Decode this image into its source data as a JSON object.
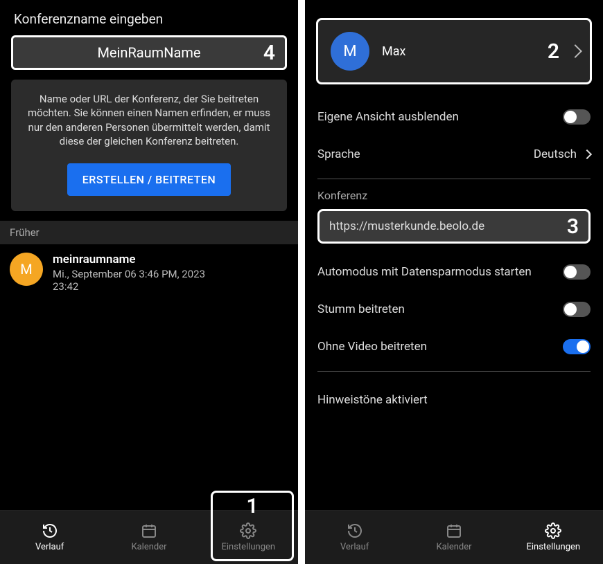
{
  "left": {
    "header": "Konferenzname eingeben",
    "room_input": "MeinRaumName",
    "badge4": "4",
    "info_text": "Name oder URL der Konferenz, der Sie beitreten möchten. Sie können einen Namen erfinden, er muss nur den anderen Personen übermittelt werden, damit diese der gleichen Konferenz beitreten.",
    "create_btn": "ERSTELLEN / BEITRETEN",
    "earlier_label": "Früher",
    "history": {
      "avatar_letter": "M",
      "title": "meinraumname",
      "subtitle": "Mi., September 06 3:46 PM, 2023",
      "duration": "23:42"
    },
    "badge1": "1"
  },
  "right": {
    "profile": {
      "avatar_letter": "M",
      "name": "Max",
      "badge2": "2"
    },
    "hide_self": "Eigene Ansicht ausblenden",
    "language_label": "Sprache",
    "language_value": "Deutsch",
    "conference_section": "Konferenz",
    "url": "https://musterkunde.beolo.de",
    "badge3": "3",
    "auto_mode": "Automodus mit Datensparmodus starten",
    "mute_join": "Stumm beitreten",
    "no_video": "Ohne Video beitreten",
    "tones": "Hinweistöne aktiviert"
  },
  "nav": {
    "history": "Verlauf",
    "calendar": "Kalender",
    "settings": "Einstellungen"
  }
}
